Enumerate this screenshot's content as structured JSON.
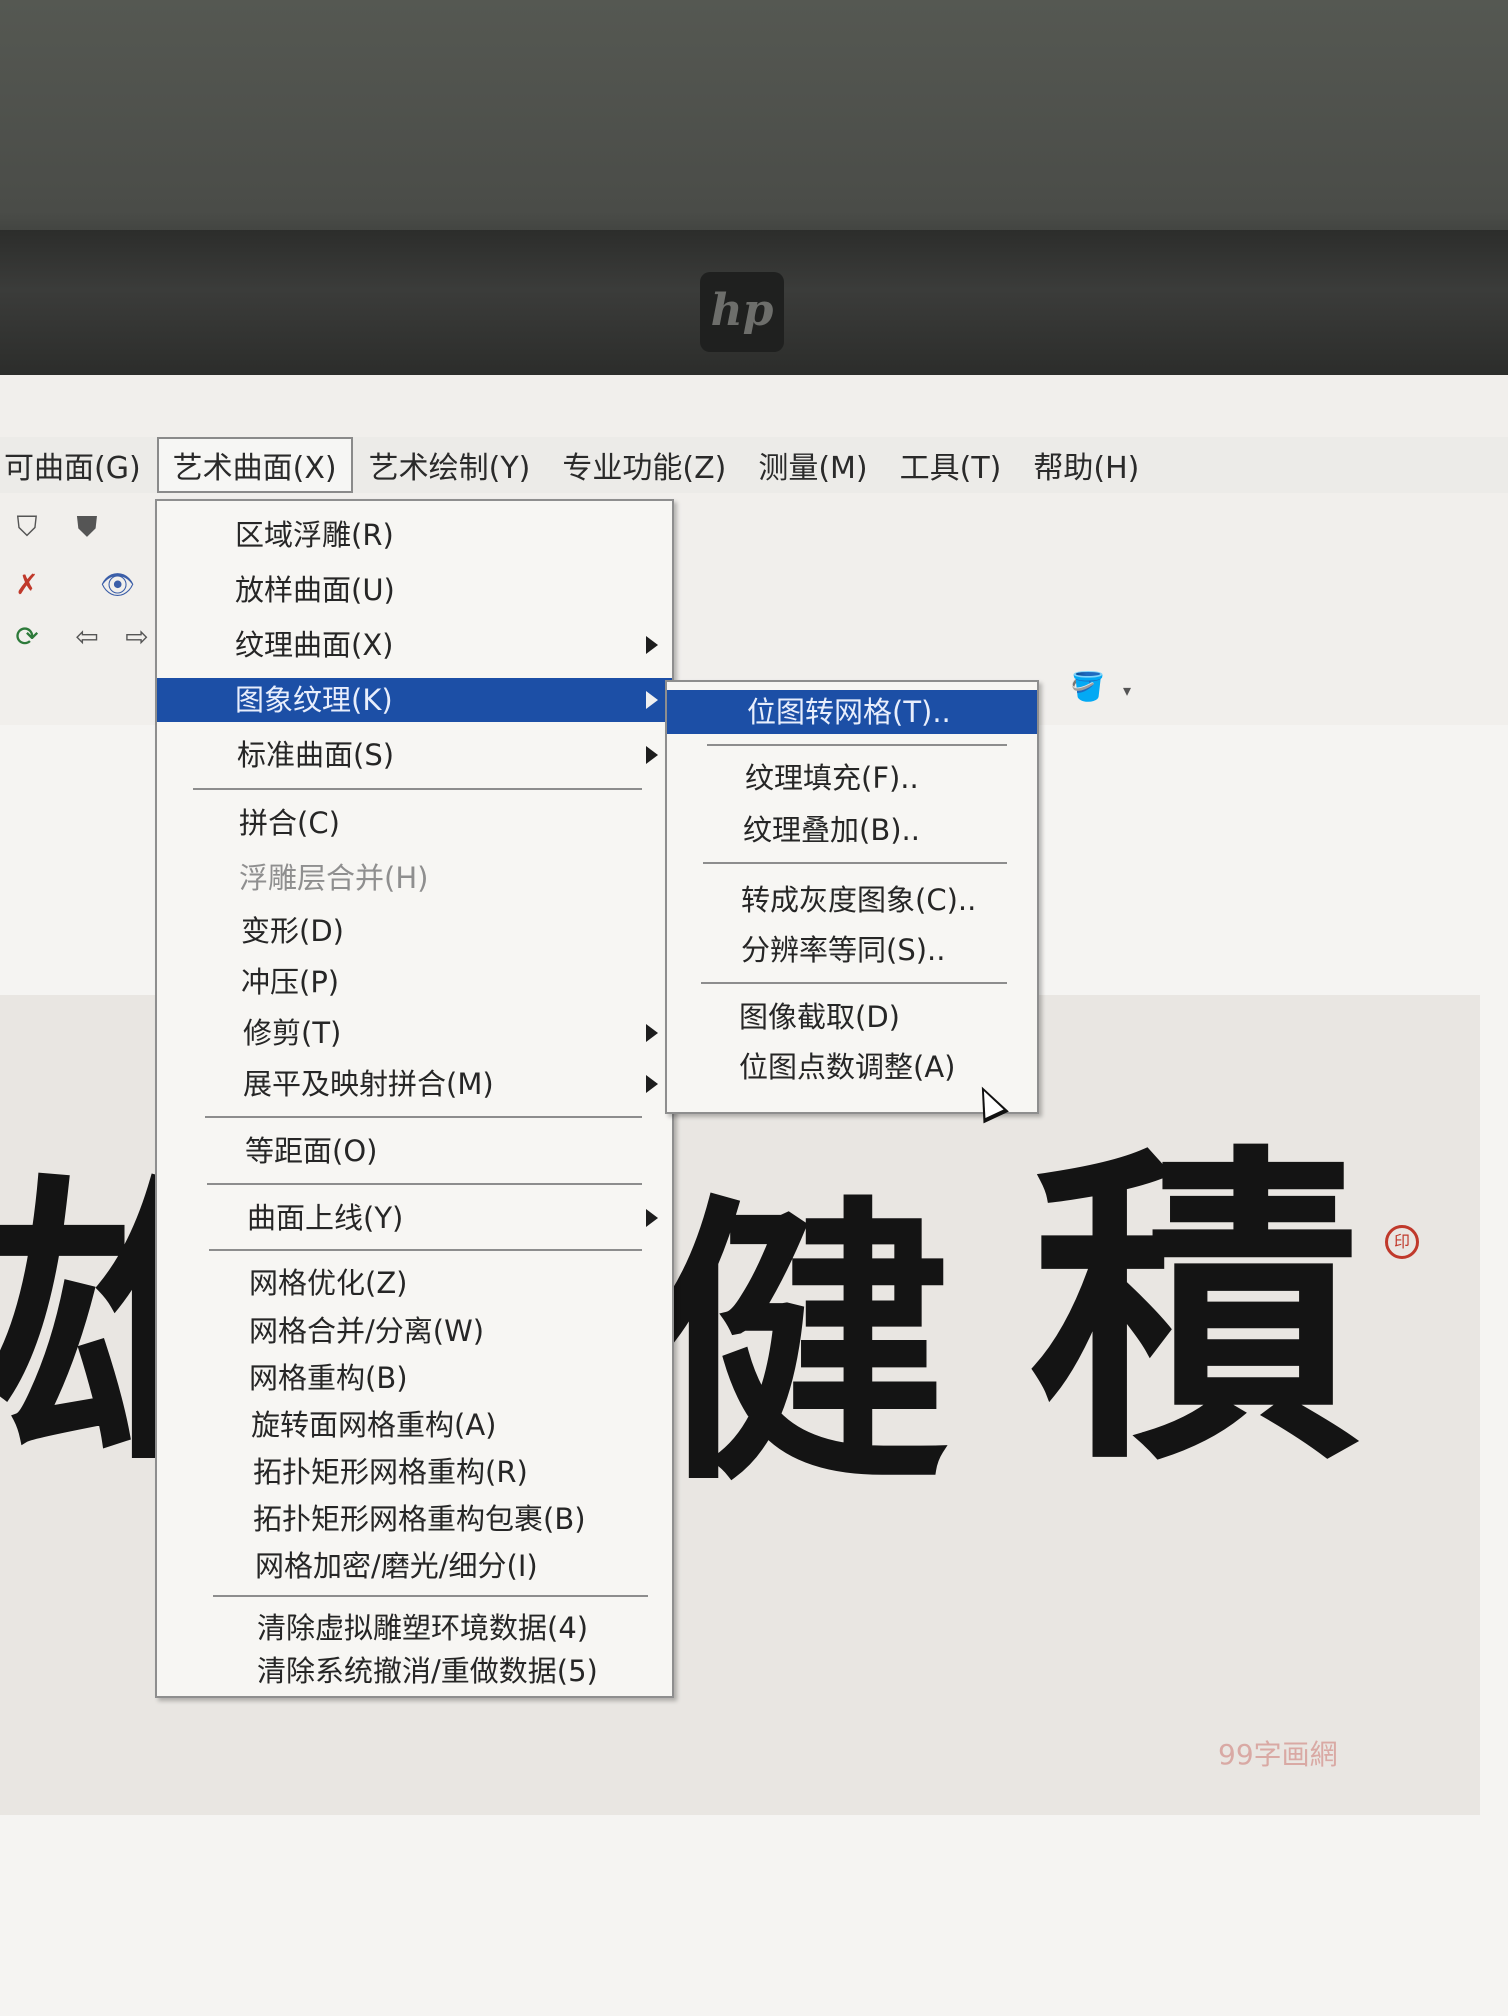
{
  "monitor": {
    "brand": "hp"
  },
  "menubar": {
    "items": [
      "可曲面(G)",
      "艺术曲面(X)",
      "艺术绘制(Y)",
      "专业功能(Z)",
      "测量(M)",
      "工具(T)",
      "帮助(H)"
    ]
  },
  "art_surface_menu": {
    "items": [
      {
        "label": "区域浮雕(R)",
        "submenu": false
      },
      {
        "label": "放样曲面(U)",
        "submenu": false
      },
      {
        "label": "纹理曲面(X)",
        "submenu": true
      },
      {
        "label": "图象纹理(K)",
        "submenu": true,
        "highlighted": true
      },
      {
        "label": "标准曲面(S)",
        "submenu": true
      },
      {
        "label": "拼合(C)",
        "submenu": false
      },
      {
        "label": "浮雕层合并(H)",
        "submenu": false,
        "disabled": true
      },
      {
        "label": "变形(D)",
        "submenu": false
      },
      {
        "label": "冲压(P)",
        "submenu": false
      },
      {
        "label": "修剪(T)",
        "submenu": true
      },
      {
        "label": "展平及映射拼合(M)",
        "submenu": true
      },
      {
        "label": "等距面(O)",
        "submenu": false
      },
      {
        "label": "曲面上线(Y)",
        "submenu": true
      },
      {
        "label": "网格优化(Z)",
        "submenu": false
      },
      {
        "label": "网格合并/分离(W)",
        "submenu": false
      },
      {
        "label": "网格重构(B)",
        "submenu": false
      },
      {
        "label": "旋转面网格重构(A)",
        "submenu": false
      },
      {
        "label": "拓扑矩形网格重构(R)",
        "submenu": false
      },
      {
        "label": "拓扑矩形网格重构包裹(B)",
        "submenu": false
      },
      {
        "label": "网格加密/磨光/细分(I)",
        "submenu": false
      },
      {
        "label": "清除虚拟雕塑环境数据(4)",
        "submenu": false
      },
      {
        "label": "清除系统撤消/重做数据(5)",
        "submenu": false
      }
    ]
  },
  "image_texture_submenu": {
    "items": [
      {
        "label": "位图转网格(T)..",
        "highlighted": true
      },
      {
        "label": "纹理填充(F).."
      },
      {
        "label": "纹理叠加(B).."
      },
      {
        "label": "转成灰度图象(C).."
      },
      {
        "label": "分辨率等同(S).."
      },
      {
        "label": "图像截取(D)"
      },
      {
        "label": "位图点数调整(A)"
      }
    ]
  },
  "artwork": {
    "characters": [
      "雄",
      "健",
      "積"
    ],
    "watermark": "99字画網"
  },
  "colors": {
    "highlight": "#1c4fa6",
    "menu_bg": "#f7f6f3",
    "ink": "#141414",
    "seal": "#c0392b"
  }
}
